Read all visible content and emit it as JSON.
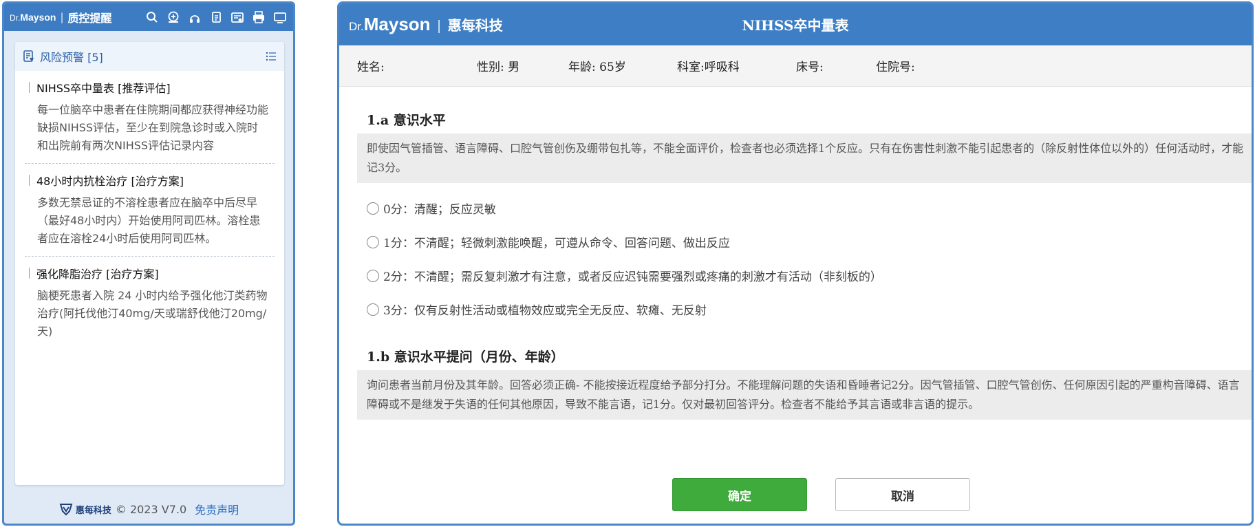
{
  "left_panel": {
    "logo_dr": "Dr.",
    "logo_mayson": "Mayson",
    "separator": "|",
    "title": "质控提醒",
    "toolbar_icons": [
      "search-icon",
      "medical-kit-icon",
      "consultation-icon",
      "document-icon",
      "report-icon",
      "printer-icon",
      "monitor-icon"
    ],
    "card": {
      "title": "风险预警 [5]",
      "alerts": [
        {
          "title": "NIHSS卒中量表 [推荐评估]",
          "body": "每一位脑卒中患者在住院期间都应获得神经功能缺损NIHSS评估，至少在到院急诊时或入院时和出院前有两次NIHSS评估记录内容"
        },
        {
          "title": "48小时内抗栓治疗 [治疗方案]",
          "body": "多数无禁忌证的不溶栓患者应在脑卒中后尽早（最好48小时内）开始使用阿司匹林。溶栓患者应在溶栓24小时后使用阿司匹林。"
        },
        {
          "title": "强化降脂治疗 [治疗方案]",
          "body": "脑梗死患者入院 24 小时内给予强化他汀类药物治疗(阿托伐他汀40mg/天或瑞舒伐他汀20mg/天)"
        }
      ]
    },
    "footer": {
      "brand": "惠每科技",
      "copyright": "© 2023 V7.0",
      "disclaimer": "免责声明"
    }
  },
  "right_panel": {
    "logo_dr": "Dr.",
    "logo_mayson": "Mayson",
    "separator": "|",
    "company": "惠每科技",
    "title": "NIHSS卒中量表",
    "patient": {
      "name_label": "姓名:",
      "gender_label": "性别:",
      "gender": "男",
      "age_label": "年龄:",
      "age": "65岁",
      "dept_label": "科室:",
      "dept": "呼吸科",
      "bed_label": "床号:",
      "admission_label": "住院号:"
    },
    "sections": [
      {
        "title": "1.a 意识水平",
        "description": "即使因气管插管、语言障碍、口腔气管创伤及绷带包扎等，不能全面评价，检查者也必须选择1个反应。只有在伤害性刺激不能引起患者的（除反射性体位以外的）任何活动时，才能记3分。",
        "options": [
          "0分：清醒；反应灵敏",
          "1分：不清醒；轻微刺激能唤醒，可遵从命令、回答问题、做出反应",
          "2分：不清醒；需反复刺激才有注意，或者反应迟钝需要强烈或疼痛的刺激才有活动（非刻板的）",
          "3分：仅有反射性活动或植物效应或完全无反应、软瘫、无反射"
        ]
      },
      {
        "title": "1.b 意识水平提问（月份、年龄）",
        "description": "询问患者当前月份及其年龄。回答必须正确- 不能按接近程度给予部分打分。不能理解问题的失语和昏睡者记2分。因气管插管、口腔气管创伤、任何原因引起的严重构音障碍、语言障碍或不是继发于失语的任何其他原因，导致不能言语，记1分。仅对最初回答评分。检查者不能给予其言语或非言语的提示。"
      }
    ],
    "buttons": {
      "ok": "确定",
      "cancel": "取消"
    },
    "colors": {
      "header_blue": "#3e7ec5",
      "ok_green": "#3eab3c"
    }
  }
}
